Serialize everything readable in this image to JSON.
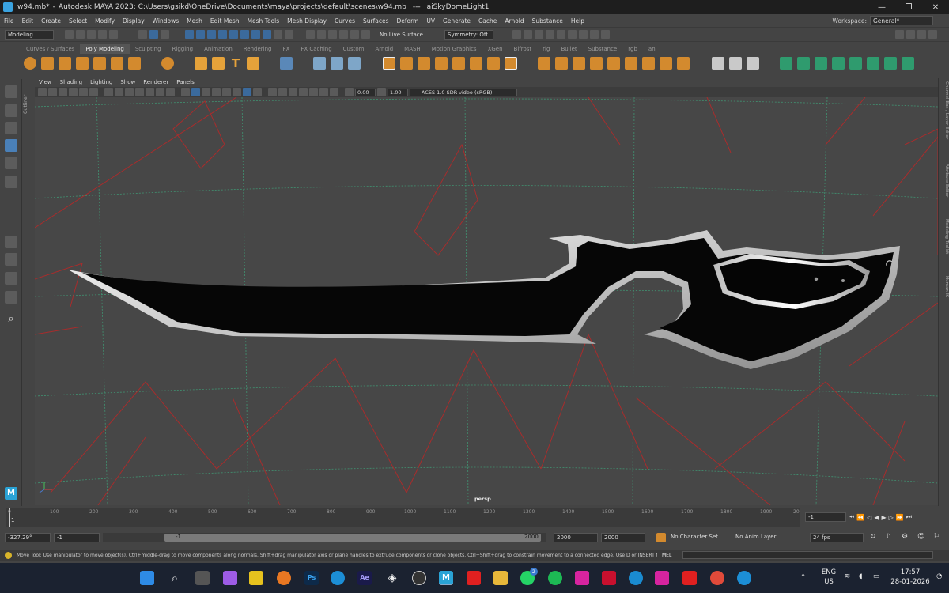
{
  "titlebar": {
    "doc": "w94.mb*",
    "title": "Autodesk MAYA 2023: C:\\Users\\gsikd\\OneDrive\\Documents\\maya\\projects\\default\\scenes\\w94.mb",
    "sep": "---",
    "selection": "aiSkyDomeLight1",
    "controls": [
      "—",
      "❐",
      "✕"
    ]
  },
  "menu": {
    "items": [
      "File",
      "Edit",
      "Create",
      "Select",
      "Modify",
      "Display",
      "Windows",
      "Mesh",
      "Edit Mesh",
      "Mesh Tools",
      "Mesh Display",
      "Curves",
      "Surfaces",
      "Deform",
      "UV",
      "Generate",
      "Cache",
      "Arnold",
      "Substance",
      "Help"
    ],
    "workspace_label": "Workspace:",
    "workspace_value": "General*"
  },
  "status": {
    "mode": "Modeling",
    "live_surface": "No Live Surface",
    "symmetry": "Symmetry: Off"
  },
  "shelf_tabs": [
    "Curves / Surfaces",
    "Poly Modeling",
    "Sculpting",
    "Rigging",
    "Animation",
    "Rendering",
    "FX",
    "FX Caching",
    "Custom",
    "Arnold",
    "MASH",
    "Motion Graphics",
    "XGen",
    "Bifrost",
    "rig",
    "Bullet",
    "Substance",
    "rgb",
    "ani"
  ],
  "shelf_active": "Poly Modeling",
  "panel": {
    "menus": [
      "View",
      "Shading",
      "Lighting",
      "Show",
      "Renderer",
      "Panels"
    ],
    "exposure": "0.00",
    "gamma": "1.00",
    "colorspace": "ACES 1.0 SDR-video (sRGB)",
    "camera": "persp"
  },
  "side_tabs": [
    "Channel Box / Layer Editor",
    "Attribute Editor",
    "Modeling Toolkit",
    "Human IK"
  ],
  "outliner_label": "Outliner",
  "timeline": {
    "ticks": [
      "0",
      "100",
      "200",
      "300",
      "400",
      "500",
      "600",
      "700",
      "800",
      "900",
      "1000",
      "1100",
      "1200",
      "1300",
      "1400",
      "1500",
      "1600",
      "1700",
      "1800",
      "1900",
      "20"
    ],
    "current_frame": "1",
    "frame_field": "-1"
  },
  "range": {
    "value_field": "-327.29°",
    "start": "-1",
    "range_start": "-1",
    "range_end": "2000",
    "end1": "2000",
    "end2": "2000",
    "character_set": "No Character Set",
    "anim_layer": "No Anim Layer",
    "fps": "24 fps"
  },
  "help": {
    "text": "Move Tool: Use manipulator to move object(s). Ctrl+middle-drag to move components along normals. Shift+drag manipulator axis or plane handles to extrude components or clone objects. Ctrl+Shift+drag to constrain movement to a connected edge. Use D or INSERT to change the pivot p",
    "mel": "MEL"
  },
  "taskbar": {
    "lang1": "ENG",
    "lang2": "US",
    "time": "17:57",
    "date": "28-01-2026",
    "badge": "2",
    "ps_label": "Ps",
    "ae_label": "Ae"
  },
  "colors": {
    "accent": "#3aa3e0",
    "grid_green": "#3fa57c",
    "grid_red": "#a82c2c",
    "mesh_dark": "#050505",
    "mesh_light": "#f0f0f0"
  }
}
